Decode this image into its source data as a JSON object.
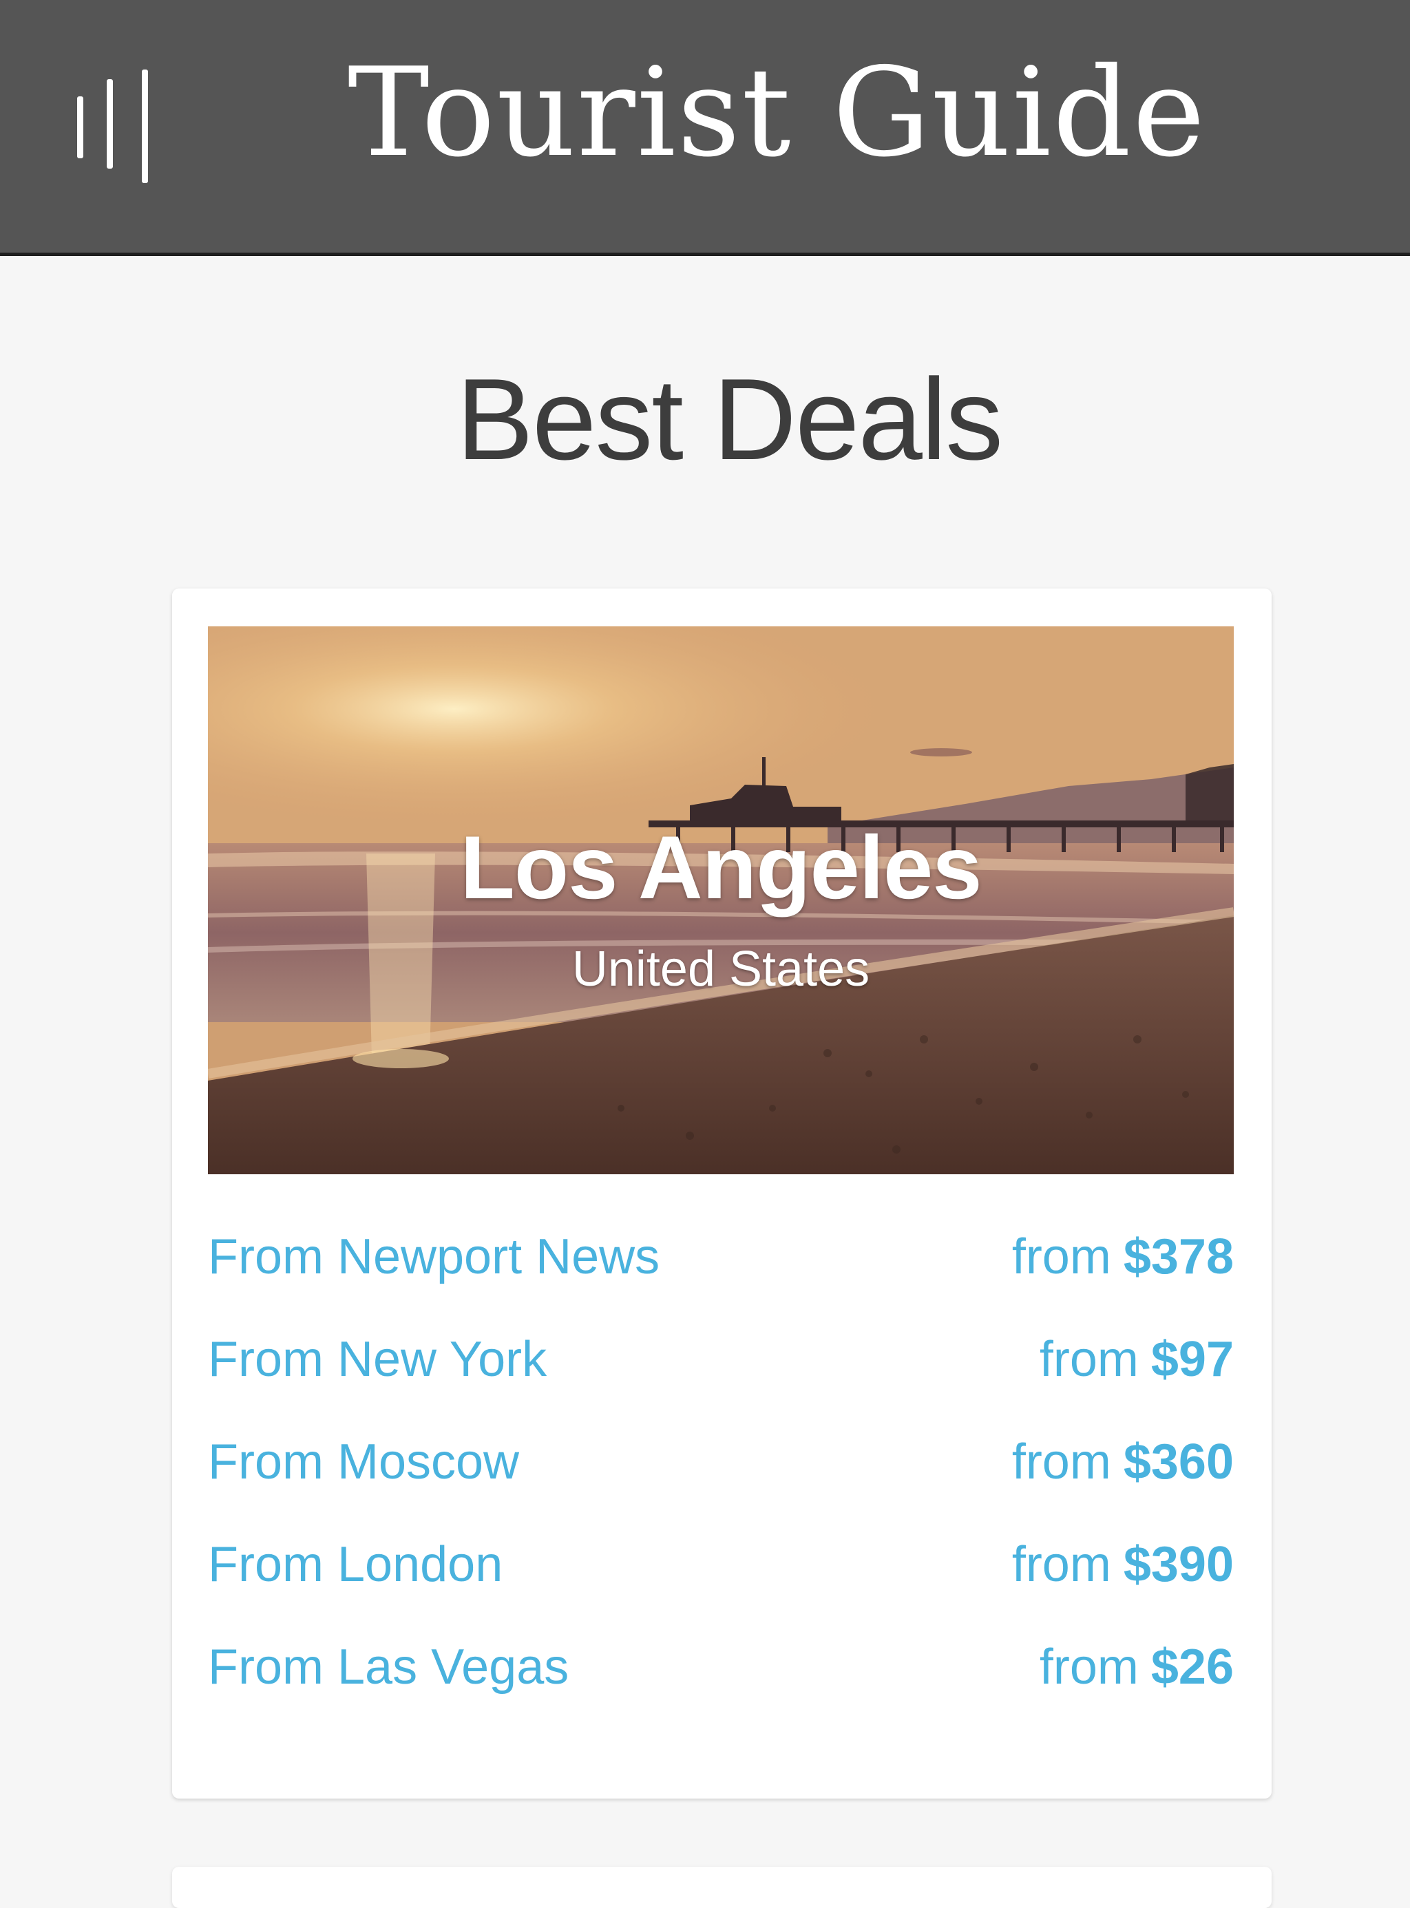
{
  "header": {
    "title": "Tourist Guide",
    "menu_icon": "menu-icon"
  },
  "section": {
    "title": "Best Deals"
  },
  "deal_card": {
    "city": "Los Angeles",
    "country": "United States",
    "image": "beach-sunset-pier",
    "deals": [
      {
        "origin": "From Newport News",
        "prefix": "from",
        "price": "$378"
      },
      {
        "origin": "From New York",
        "prefix": "from",
        "price": "$97"
      },
      {
        "origin": "From Moscow",
        "prefix": "from",
        "price": "$360"
      },
      {
        "origin": "From London",
        "prefix": "from",
        "price": "$390"
      },
      {
        "origin": "From Las Vegas",
        "prefix": "from",
        "price": "$26"
      }
    ]
  },
  "colors": {
    "header_bg": "#555555",
    "page_bg": "#f6f6f6",
    "link": "#49b2de",
    "title_text": "#3d3d3d"
  }
}
